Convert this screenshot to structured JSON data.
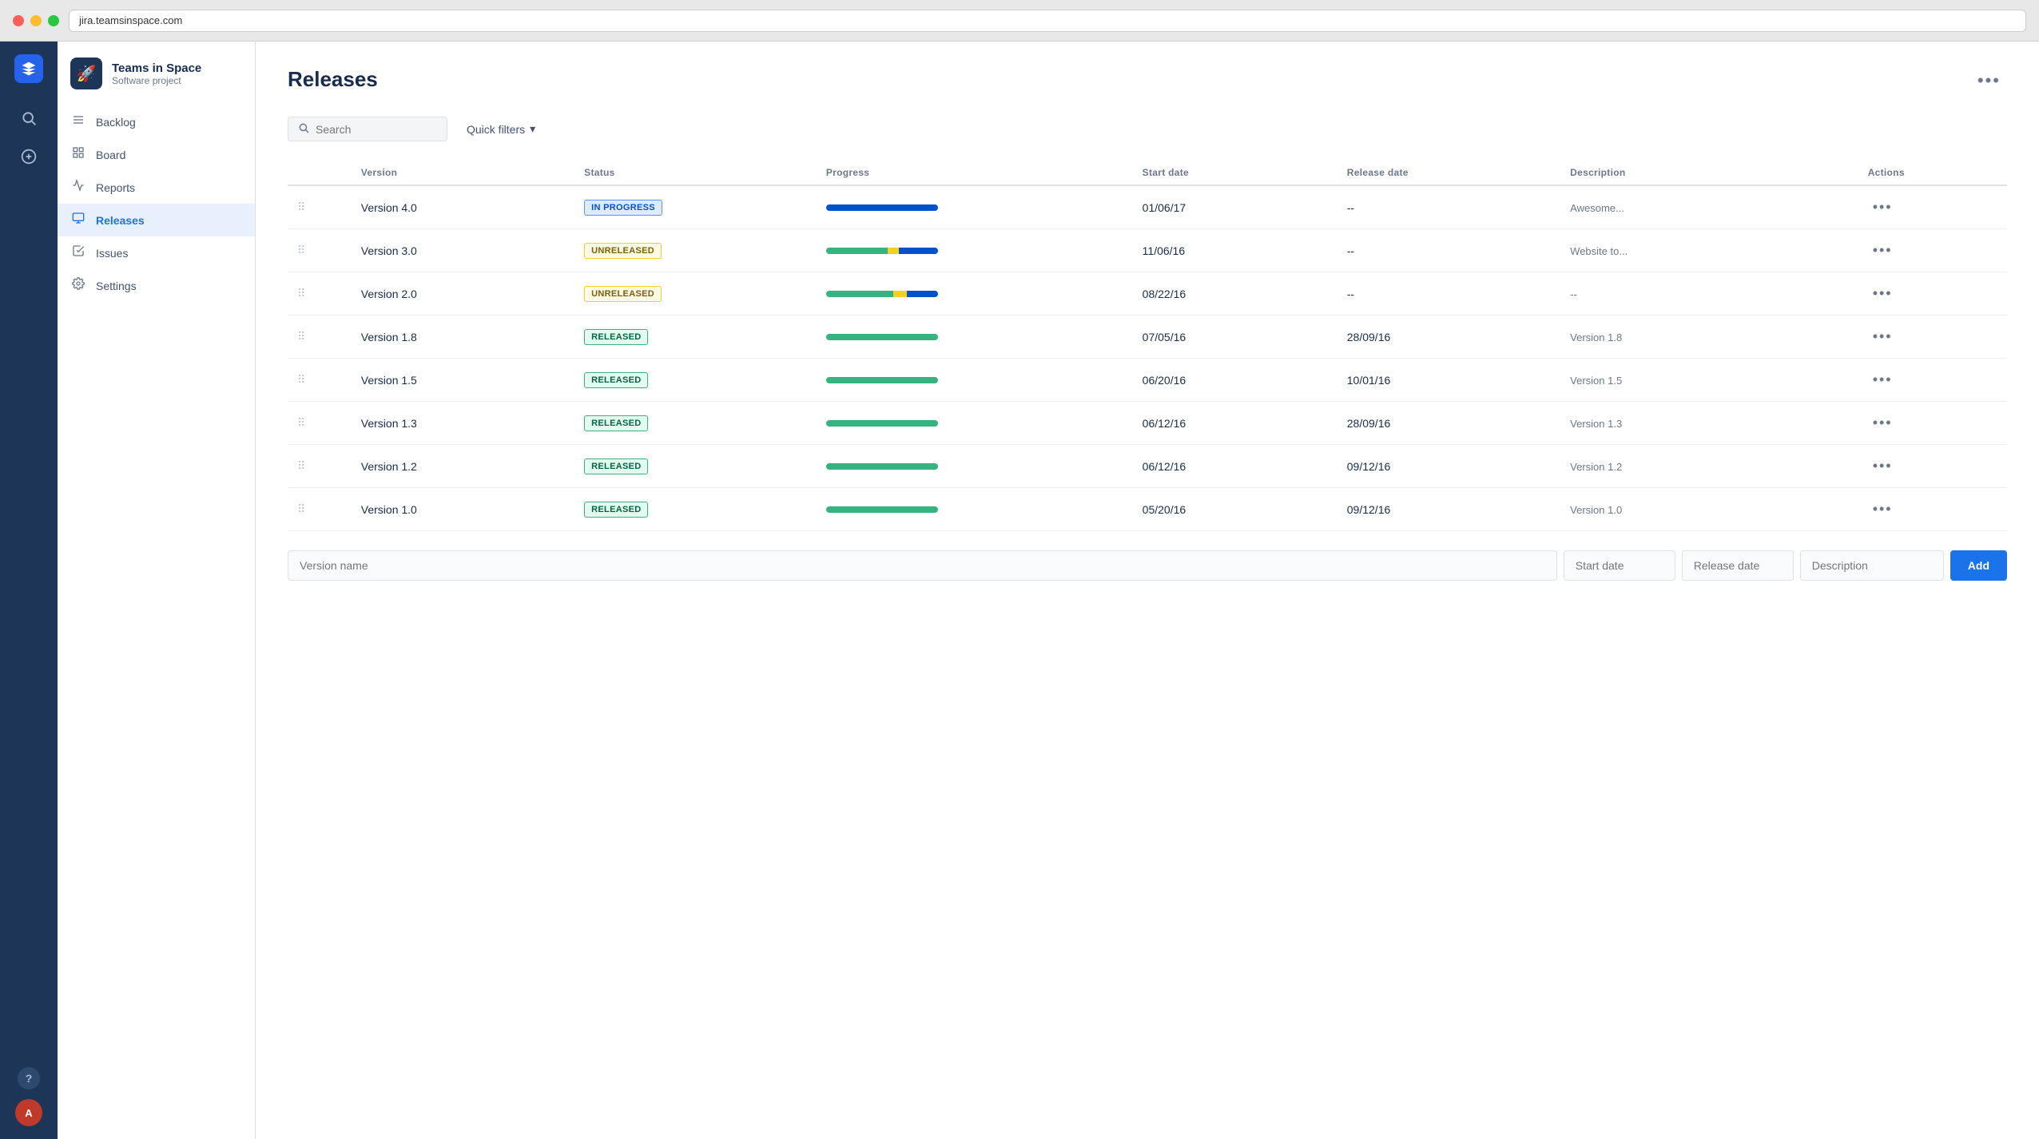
{
  "browser": {
    "url": "jira.teamsinspace.com"
  },
  "sidebar": {
    "project_name": "Teams in Space",
    "project_subtitle": "Software project",
    "nav_items": [
      {
        "id": "backlog",
        "label": "Backlog",
        "icon": "≡",
        "active": false
      },
      {
        "id": "board",
        "label": "Board",
        "icon": "⊞",
        "active": false
      },
      {
        "id": "reports",
        "label": "Reports",
        "icon": "📈",
        "active": false
      },
      {
        "id": "releases",
        "label": "Releases",
        "icon": "📋",
        "active": true
      },
      {
        "id": "issues",
        "label": "Issues",
        "icon": "☑",
        "active": false
      },
      {
        "id": "settings",
        "label": "Settings",
        "icon": "⚙",
        "active": false
      }
    ]
  },
  "page": {
    "title": "Releases",
    "more_label": "•••"
  },
  "filters": {
    "search_placeholder": "Search",
    "quick_filters_label": "Quick filters"
  },
  "table": {
    "columns": [
      "",
      "Version",
      "Status",
      "Progress",
      "Start date",
      "Release date",
      "Description",
      "Actions"
    ],
    "rows": [
      {
        "version": "Version 4.0",
        "status": "IN PROGRESS",
        "status_type": "inprogress",
        "progress": {
          "green": 0,
          "yellow": 0,
          "blue": 100
        },
        "start_date": "01/06/17",
        "release_date": "--",
        "description": "Awesome..."
      },
      {
        "version": "Version 3.0",
        "status": "UNRELEASED",
        "status_type": "unreleased",
        "progress": {
          "green": 55,
          "yellow": 10,
          "blue": 35
        },
        "start_date": "11/06/16",
        "release_date": "--",
        "description": "Website to..."
      },
      {
        "version": "Version 2.0",
        "status": "UNRELEASED",
        "status_type": "unreleased",
        "progress": {
          "green": 60,
          "yellow": 12,
          "blue": 28
        },
        "start_date": "08/22/16",
        "release_date": "--",
        "description": "--"
      },
      {
        "version": "Version 1.8",
        "status": "RELEASED",
        "status_type": "released",
        "progress": {
          "green": 100,
          "yellow": 0,
          "blue": 0
        },
        "start_date": "07/05/16",
        "release_date": "28/09/16",
        "description": "Version 1.8"
      },
      {
        "version": "Version 1.5",
        "status": "RELEASED",
        "status_type": "released",
        "progress": {
          "green": 100,
          "yellow": 0,
          "blue": 0
        },
        "start_date": "06/20/16",
        "release_date": "10/01/16",
        "description": "Version 1.5"
      },
      {
        "version": "Version 1.3",
        "status": "RELEASED",
        "status_type": "released",
        "progress": {
          "green": 100,
          "yellow": 0,
          "blue": 0
        },
        "start_date": "06/12/16",
        "release_date": "28/09/16",
        "description": "Version 1.3"
      },
      {
        "version": "Version 1.2",
        "status": "RELEASED",
        "status_type": "released",
        "progress": {
          "green": 100,
          "yellow": 0,
          "blue": 0
        },
        "start_date": "06/12/16",
        "release_date": "09/12/16",
        "description": "Version 1.2"
      },
      {
        "version": "Version 1.0",
        "status": "RELEASED",
        "status_type": "released",
        "progress": {
          "green": 100,
          "yellow": 0,
          "blue": 0
        },
        "start_date": "05/20/16",
        "release_date": "09/12/16",
        "description": "Version 1.0"
      }
    ]
  },
  "add_form": {
    "version_placeholder": "Version name",
    "start_date_placeholder": "Start date",
    "release_date_placeholder": "Release date",
    "description_placeholder": "Description",
    "add_button_label": "Add"
  }
}
